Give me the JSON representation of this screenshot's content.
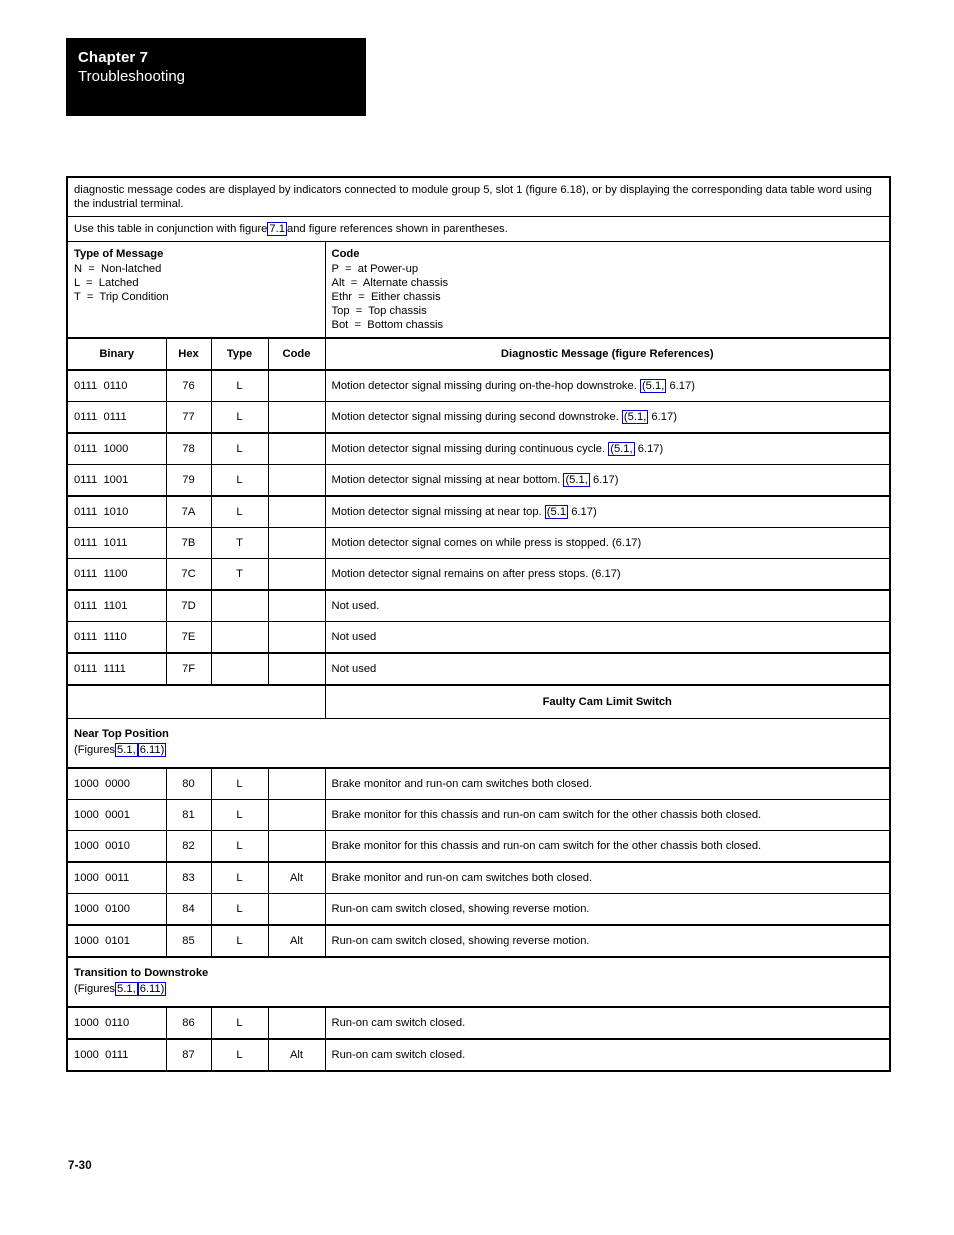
{
  "header": {
    "chapter": "Chapter 7",
    "title": "Troubleshooting"
  },
  "intro": {
    "paragraph1": "diagnostic message codes are displayed by indicators connected to module group 5, slot 1 (figure 6.18), or by displaying the corresponding data table word using the industrial terminal.",
    "paragraph2_before": "Use this table in conjunction with figure",
    "paragraph2_link": "7.1",
    "paragraph2_after": "and figure references shown in parentheses."
  },
  "legend": {
    "type_of_message": {
      "title": "Type of Message",
      "lines": [
        "N  =  Non-latched",
        "L  =  Latched",
        "T  =  Trip Condition"
      ]
    },
    "code": {
      "title": "Code",
      "lines": [
        "P  =  at Power-up",
        "Alt  =  Alternate chassis",
        "Ethr  =  Either chassis",
        "Top  =  Top chassis",
        "Bot  =  Bottom chassis"
      ]
    }
  },
  "table": {
    "columns": {
      "binary": "Binary",
      "hex": "Hex",
      "type": "Type",
      "code": "Code",
      "message": "Diagnostic Message (figure  References)"
    },
    "rows": [
      {
        "binary": "0111  0110",
        "hex": "76",
        "type": "L",
        "code": "",
        "msg_before": "Motion detector signal missing during on-the-hop downstroke.",
        "msg_link": "(5.1,",
        "msg_after": "6.17)"
      },
      {
        "binary": "0111  0111",
        "hex": "77",
        "type": "L",
        "code": "",
        "msg_before": "Motion detector signal missing during second downstroke.",
        "msg_link": "(5.1,",
        "msg_after": "6.17)"
      },
      {
        "binary": "0111  1000",
        "hex": "78",
        "type": "L",
        "code": "",
        "msg_before": "Motion detector signal missing during continuous cycle.",
        "msg_link": "(5.1,",
        "msg_after": "6.17)"
      },
      {
        "binary": "0111  1001",
        "hex": "79",
        "type": "L",
        "code": "",
        "msg_before": "Motion detector signal missing at near bottom.",
        "msg_link": "(5.1,",
        "msg_after": "6.17)"
      },
      {
        "binary": "0111  1010",
        "hex": "7A",
        "type": "L",
        "code": "",
        "msg_before": "Motion detector signal missing at near top.",
        "msg_link": "(5.1",
        "msg_after": "6.17)"
      },
      {
        "binary": "0111  1011",
        "hex": "7B",
        "type": "T",
        "code": "",
        "msg_before": "Motion detector signal comes on while press is stopped.  (6.17)",
        "msg_link": "",
        "msg_after": ""
      },
      {
        "binary": "0111  1100",
        "hex": "7C",
        "type": "T",
        "code": "",
        "msg_before": "Motion detector signal remains on after press stops.  (6.17)",
        "msg_link": "",
        "msg_after": ""
      },
      {
        "binary": "0111  1101",
        "hex": "7D",
        "type": "",
        "code": "",
        "msg_before": "Not used.",
        "msg_link": "",
        "msg_after": ""
      },
      {
        "binary": "0111  1110",
        "hex": "7E",
        "type": "",
        "code": "",
        "msg_before": "Not used",
        "msg_link": "",
        "msg_after": ""
      },
      {
        "binary": "0111  1111",
        "hex": "7F",
        "type": "",
        "code": "",
        "msg_before": "Not used",
        "msg_link": "",
        "msg_after": ""
      }
    ],
    "section_banner": "Faulty Cam Limit Switch",
    "group1": {
      "title": "Near Top Position",
      "sub_before": "(Figures",
      "sub_link1": "5.1,",
      "sub_link2": "6.11)"
    },
    "group1_rows": [
      {
        "binary": "1000  0000",
        "hex": "80",
        "type": "L",
        "code": "",
        "msg_before": "Brake monitor and run-on cam switches both closed.",
        "msg_link": "",
        "msg_after": ""
      },
      {
        "binary": "1000  0001",
        "hex": "81",
        "type": "L",
        "code": "",
        "msg_before": "Brake monitor for this chassis and run-on cam switch for the other chassis both closed.",
        "msg_link": "",
        "msg_after": ""
      },
      {
        "binary": "1000  0010",
        "hex": "82",
        "type": "L",
        "code": "",
        "msg_before": "Brake monitor for this chassis and run-on cam switch for the other chassis both closed.",
        "msg_link": "",
        "msg_after": ""
      },
      {
        "binary": "1000  0011",
        "hex": "83",
        "type": "L",
        "code": "Alt",
        "msg_before": "Brake monitor and run-on cam switches both closed.",
        "msg_link": "",
        "msg_after": ""
      },
      {
        "binary": "1000  0100",
        "hex": "84",
        "type": "L",
        "code": "",
        "msg_before": "Run-on cam switch closed, showing reverse motion.",
        "msg_link": "",
        "msg_after": ""
      },
      {
        "binary": "1000  0101",
        "hex": "85",
        "type": "L",
        "code": "Alt",
        "msg_before": "Run-on cam switch closed, showing reverse motion.",
        "msg_link": "",
        "msg_after": ""
      }
    ],
    "group2": {
      "title": "Transition to Downstroke",
      "sub_before": "(Figures",
      "sub_link1": "5.1,",
      "sub_link2": "6.11)"
    },
    "group2_rows": [
      {
        "binary": "1000  0110",
        "hex": "86",
        "type": "L",
        "code": "",
        "msg_before": "Run-on cam switch closed.",
        "msg_link": "",
        "msg_after": ""
      },
      {
        "binary": "1000  0111",
        "hex": "87",
        "type": "L",
        "code": "Alt",
        "msg_before": "Run-on cam switch closed.",
        "msg_link": "",
        "msg_after": ""
      }
    ]
  },
  "footer": {
    "page_number": "7-30"
  },
  "colors": {
    "link_box": "#0000d8",
    "banner_bg": "#000000",
    "text": "#000000"
  }
}
